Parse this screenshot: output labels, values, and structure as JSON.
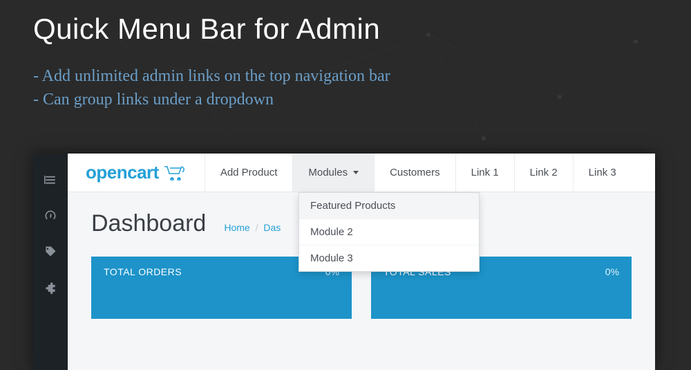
{
  "hero": {
    "title": "Quick Menu Bar for Admin",
    "features": [
      "- Add unlimited admin links on the top navigation bar",
      "- Can group links under a dropdown"
    ]
  },
  "logo": {
    "text": "opencart"
  },
  "nav": {
    "items": [
      {
        "label": "Add Product"
      },
      {
        "label": "Modules",
        "dropdown": true
      },
      {
        "label": "Customers"
      },
      {
        "label": "Link 1"
      },
      {
        "label": "Link 2"
      },
      {
        "label": "Link 3"
      }
    ]
  },
  "dropdown": {
    "items": [
      {
        "label": "Featured Products"
      },
      {
        "label": "Module 2"
      },
      {
        "label": "Module 3"
      }
    ]
  },
  "page": {
    "title": "Dashboard",
    "breadcrumb": {
      "home": "Home",
      "sep": "/",
      "current": "Das"
    }
  },
  "cards": {
    "orders": {
      "title": "TOTAL ORDERS",
      "pct": "0%",
      "value": ""
    },
    "sales": {
      "title": "TOTAL SALES",
      "pct": "0%",
      "value": ""
    }
  }
}
